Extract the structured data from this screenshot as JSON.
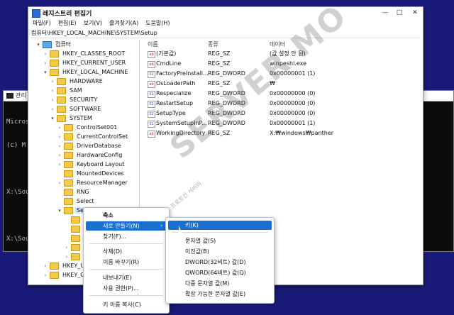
{
  "cmd": {
    "title": "관리",
    "lines": [
      "Micros",
      "(c) M",
      "",
      "X:\\Sou",
      "",
      "X:\\Sou"
    ]
  },
  "window": {
    "title": "레지스트리 편집기",
    "minimize": "—",
    "maximize": "□",
    "close": "✕"
  },
  "menu": [
    "파일(F)",
    "편집(E)",
    "보기(V)",
    "즐겨찾기(A)",
    "도움말(H)"
  ],
  "address": "컴퓨터\\HKEY_LOCAL_MACHINE\\SYSTEM\\Setup",
  "tree": [
    {
      "label": "컴퓨터",
      "twisty": "▾",
      "icon": "computer"
    },
    {
      "label": "HKEY_CLASSES_ROOT",
      "twisty": "›",
      "icon": "folder"
    },
    {
      "label": "HKEY_CURRENT_USER",
      "twisty": "›",
      "icon": "folder"
    },
    {
      "label": "HKEY_LOCAL_MACHINE",
      "twisty": "▾",
      "icon": "folder"
    },
    {
      "label": "HARDWARE",
      "twisty": "›",
      "icon": "folder"
    },
    {
      "label": "SAM",
      "twisty": "›",
      "icon": "folder"
    },
    {
      "label": "SECURITY",
      "twisty": "›",
      "icon": "folder"
    },
    {
      "label": "SOFTWARE",
      "twisty": "›",
      "icon": "folder"
    },
    {
      "label": "SYSTEM",
      "twisty": "▾",
      "icon": "folder"
    },
    {
      "label": "ControlSet001",
      "twisty": "›",
      "icon": "folder"
    },
    {
      "label": "CurrentControlSet",
      "twisty": "›",
      "icon": "folder"
    },
    {
      "label": "DriverDatabase",
      "twisty": "›",
      "icon": "folder"
    },
    {
      "label": "HardwareConfig",
      "twisty": "›",
      "icon": "folder"
    },
    {
      "label": "Keyboard Layout",
      "twisty": "›",
      "icon": "folder"
    },
    {
      "label": "MountedDevices",
      "twisty": "",
      "icon": "folder"
    },
    {
      "label": "ResourceManager",
      "twisty": "›",
      "icon": "folder"
    },
    {
      "label": "RNG",
      "twisty": "",
      "icon": "folder"
    },
    {
      "label": "Select",
      "twisty": "",
      "icon": "folder"
    },
    {
      "label": "Setup",
      "twisty": "▾",
      "icon": "folder"
    },
    {
      "label": "",
      "twisty": "",
      "icon": "folder"
    },
    {
      "label": "",
      "twisty": "",
      "icon": "folder"
    },
    {
      "label": "",
      "twisty": "",
      "icon": "folder"
    },
    {
      "label": "So",
      "twisty": "›",
      "icon": "folder"
    },
    {
      "label": "W",
      "twisty": "›",
      "icon": "folder"
    },
    {
      "label": "HKEY_US",
      "twisty": "›",
      "icon": "folder"
    },
    {
      "label": "HKEY_CU",
      "twisty": "›",
      "icon": "folder"
    }
  ],
  "list": {
    "headers": {
      "name": "이름",
      "type": "종류",
      "data": "데이터"
    },
    "rows": [
      {
        "icon": "ab",
        "name": "(기본값)",
        "type": "REG_SZ",
        "data": "(값 설정 안 됨)"
      },
      {
        "icon": "ab",
        "name": "CmdLine",
        "type": "REG_SZ",
        "data": "winpeshl.exe"
      },
      {
        "icon": "bin",
        "name": "FactoryPreInstall...",
        "type": "REG_DWORD",
        "data": "0x00000001 (1)"
      },
      {
        "icon": "ab",
        "name": "OsLoaderPath",
        "type": "REG_SZ",
        "data": "₩"
      },
      {
        "icon": "bin",
        "name": "Respecialize",
        "type": "REG_DWORD",
        "data": "0x00000000 (0)"
      },
      {
        "icon": "bin",
        "name": "RestartSetup",
        "type": "REG_DWORD",
        "data": "0x00000000 (0)"
      },
      {
        "icon": "bin",
        "name": "SetupType",
        "type": "REG_DWORD",
        "data": "0x00000000 (0)"
      },
      {
        "icon": "bin",
        "name": "SystemSetupInP...",
        "type": "REG_DWORD",
        "data": "0x00000001 (1)"
      },
      {
        "icon": "ab",
        "name": "WorkingDirectory",
        "type": "REG_SZ",
        "data": "X:₩windows₩panther"
      }
    ]
  },
  "watermark": {
    "text": "SERVER MO",
    "sub": "프로토선 서버비"
  },
  "context_menu": {
    "items": [
      "축소",
      "새로 만들기(N)",
      "찾기(F)...",
      "삭제(D)",
      "이름 바꾸기(R)",
      "내보내기(E)",
      "사용 권한(P)...",
      "키 이름 복사(C)"
    ],
    "submenu_arrow": "›"
  },
  "submenu": {
    "items": [
      "키(K)",
      "문자열 값(S)",
      "이진값(B)",
      "DWORD(32비트) 값(D)",
      "QWORD(64비트) 값(Q)",
      "다중 문자열 값(M)",
      "확장 가능한 문자열 값(E)"
    ]
  }
}
